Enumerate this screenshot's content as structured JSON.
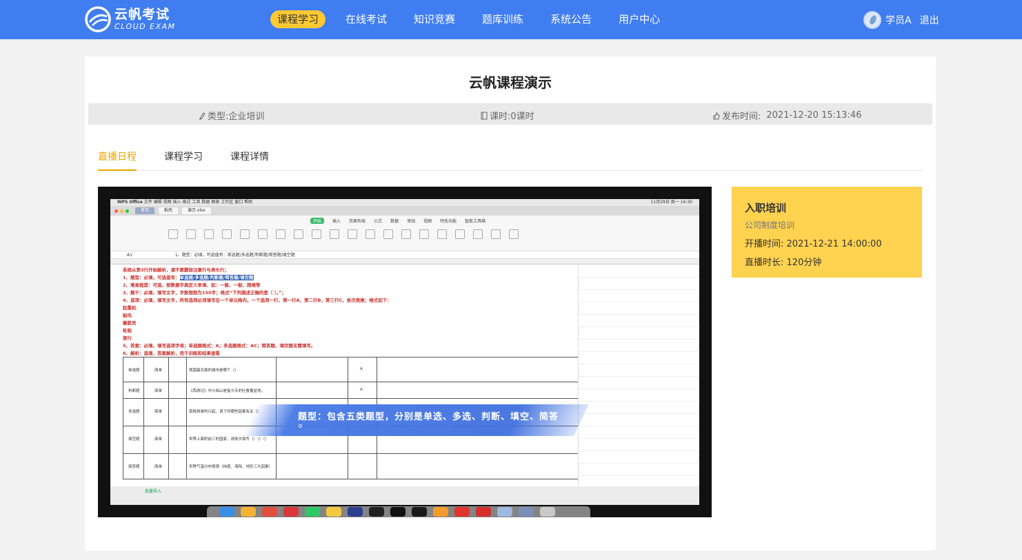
{
  "brand": {
    "name_cn": "云帆考试",
    "name_en": "CLOUD EXAM"
  },
  "nav": {
    "items": [
      {
        "label": "课程学习",
        "active": true
      },
      {
        "label": "在线考试",
        "active": false
      },
      {
        "label": "知识竞赛",
        "active": false
      },
      {
        "label": "题库训练",
        "active": false
      },
      {
        "label": "系统公告",
        "active": false
      },
      {
        "label": "用户中心",
        "active": false
      }
    ]
  },
  "user": {
    "name": "学员A",
    "logout_label": "退出"
  },
  "course": {
    "title": "云帆课程演示",
    "type_label": "类型:",
    "type_value": "企业培训",
    "hours_label": "课时:",
    "hours_value": "0课时",
    "publish_label": "发布时间:",
    "publish_value": "2021-12-20 15:13:46"
  },
  "tabs": [
    {
      "label": "直播日程",
      "active": true
    },
    {
      "label": "课程学习",
      "active": false
    },
    {
      "label": "课程详情",
      "active": false
    }
  ],
  "video": {
    "caption": "题型：包含五类题型，分别是单选、多选、判断、填空、简答",
    "caption_end": "。",
    "app_name": "WPS Office",
    "file_tab": "演示.xlsx",
    "home_tab": "首页",
    "template_tab": "稻壳",
    "cell_ref": "A1",
    "formula_text": "1、题型：必填，可选值有：单选题/多选题/判断题/简答题/填空题",
    "menu": [
      "开始",
      "插入",
      "页面布局",
      "公式",
      "数据",
      "审阅",
      "视图",
      "特色功能",
      "智能工具箱"
    ],
    "mac_menu": [
      "文件",
      "编辑",
      "视图",
      "插入",
      "格式",
      "工具",
      "数据",
      "图表",
      "工作区",
      "窗口",
      "帮助"
    ],
    "clock": "11月29日 周一 16:30",
    "notes": [
      "系统从第3行开始解析，请不要删除注意行与表头行；",
      "1、题型：必填，可选值有：",
      "2、难易程度：可选，按数据字典定义来填，如：一般、一般、困难等",
      "3、题干：必填，填写文字，字数限制为150字；格式“下列描述正确的是（ ）。”；",
      "4、选项：必填，填写文字，所有选项必须填写在一个单元格内，一个选项一行，第一行A，第二行B，第三行C，依次类推；格式如下：",
      "起重机",
      "船坞",
      "搬航员",
      "轮船",
      "旅行",
      "5、答案：必填，填写选项字母；单选题格式：A；多选题格式：AC；简答题、填空题无需填写。",
      "6、解析：选填，答案解析，用于训练和结果查看"
    ],
    "notes_highlight": "单选题/多选题/判断题/简答题/填空题",
    "rows": [
      {
        "type": "单选题",
        "level": "简单",
        "stem": "我国最北面的城市是哪个（）",
        "answer": "A"
      },
      {
        "type": "判断题",
        "level": "简单",
        "stem": "《西游记》中火焰山是指今天的吐鲁番盆地。",
        "answer": "A"
      },
      {
        "type": "多选题",
        "level": "简单",
        "stem": "南极旅游的兴起，请下列哪些因素有关（）",
        "answer": ""
      },
      {
        "type": "填空题",
        "level": "简单",
        "stem": "世界上面积前三的国家，请依次填写（）（）（）",
        "answer": ""
      },
      {
        "type": "简答题",
        "level": "简单",
        "stem": "世界气温分布规律（纬度、海陆、地形三大因素）",
        "answer": ""
      }
    ],
    "sheet_tab": "批量导入"
  },
  "live": {
    "title": "入职培训",
    "category": "公司制度培训",
    "start_label": "开播时间:",
    "start_value": "2021-12-21 14:00:00",
    "duration_label": "直播时长:",
    "duration_value": "120分钟"
  },
  "colors": {
    "nav_bg": "#3f7df0",
    "nav_active": "#ffc932",
    "tab_active": "#e8a500",
    "live_card": "#ffd24f"
  }
}
